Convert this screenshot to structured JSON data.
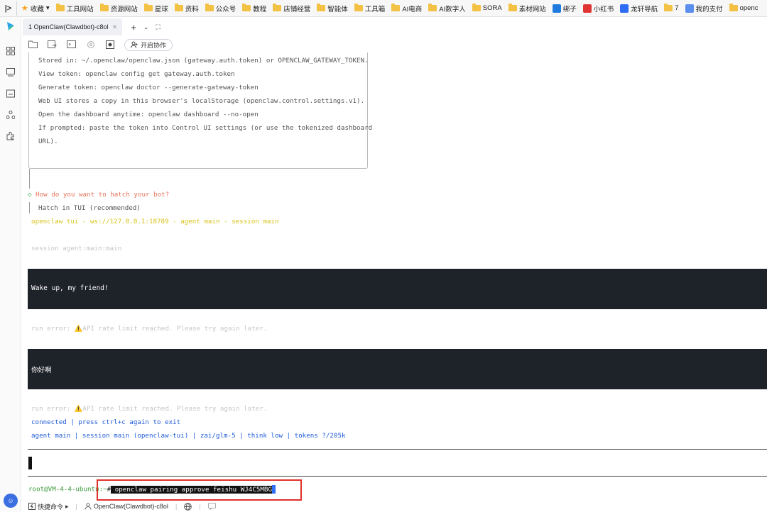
{
  "bookmarks": [
    {
      "label": "收藏",
      "icon": "star-icon",
      "has_dropdown": true
    },
    {
      "label": "工具网站",
      "icon": "folder-icon"
    },
    {
      "label": "资源网站",
      "icon": "folder-icon"
    },
    {
      "label": "星球",
      "icon": "folder-icon"
    },
    {
      "label": "资料",
      "icon": "folder-icon"
    },
    {
      "label": "公众号",
      "icon": "folder-icon"
    },
    {
      "label": "教程",
      "icon": "folder-icon"
    },
    {
      "label": "店铺经营",
      "icon": "folder-icon"
    },
    {
      "label": "智能体",
      "icon": "folder-icon"
    },
    {
      "label": "工具箱",
      "icon": "folder-icon"
    },
    {
      "label": "AI电商",
      "icon": "folder-icon"
    },
    {
      "label": "AI数字人",
      "icon": "folder-icon"
    },
    {
      "label": "SORA",
      "icon": "folder-icon"
    },
    {
      "label": "素材网站",
      "icon": "folder-icon"
    },
    {
      "label": "绑子",
      "icon": "site-icon"
    },
    {
      "label": "小红书",
      "icon": "site-icon"
    },
    {
      "label": "龙轩导航",
      "icon": "site-icon"
    },
    {
      "label": "7",
      "icon": "folder-icon"
    },
    {
      "label": "我的支付",
      "icon": "site-icon"
    },
    {
      "label": "openc",
      "icon": "folder-icon"
    }
  ],
  "tab": {
    "label": "1  OpenClaw(Clawdbot)-c8ol",
    "close": "×",
    "add": "+",
    "dropdown": "⌄",
    "fullscreen": "⛶"
  },
  "toolbar": {
    "collab_label": "开启协作"
  },
  "terminal": {
    "box_lines": [
      "Stored in: ~/.openclaw/openclaw.json (gateway.auth.token) or OPENCLAW_GATEWAY_TOKEN.",
      "View token: openclaw config get gateway.auth.token",
      "Generate token: openclaw doctor --generate-gateway-token",
      "Web UI stores a copy in this browser's localStorage (openclaw.control.settings.v1).",
      "Open the dashboard anytime: openclaw dashboard --no-open",
      "If prompted: paste the token into Control UI settings (or use the tokenized dashboard",
      "URL)."
    ],
    "question": "How do you want to hatch your bot?",
    "answer": "Hatch in TUI (recommended)",
    "tui_header": "openclaw tui - ws://127.0.0.1:18789 - agent main - session main",
    "session_line": "session agent:main:main",
    "user_msg_1": "Wake up, my friend!",
    "error_1": "run error: ⚠️API rate limit reached. Please try again later.",
    "user_msg_2": "你好啊",
    "error_2": "run error: ⚠️API rate limit reached. Please try again later.",
    "status_1": "connected | press ctrl+c again to exit",
    "status_2": "agent main | session main (openclaw-tui) | zai/glm-5 | think low | tokens ?/205k",
    "prompt_user": "root@VM-4-4-ubuntu:~",
    "prompt_hash": "#",
    "command": " openclaw pairing approve feishu WJ4C5MBG"
  },
  "statusbar": {
    "quick_cmd": "快捷命令",
    "session": "OpenClaw(Clawdbot)-c8ol"
  }
}
